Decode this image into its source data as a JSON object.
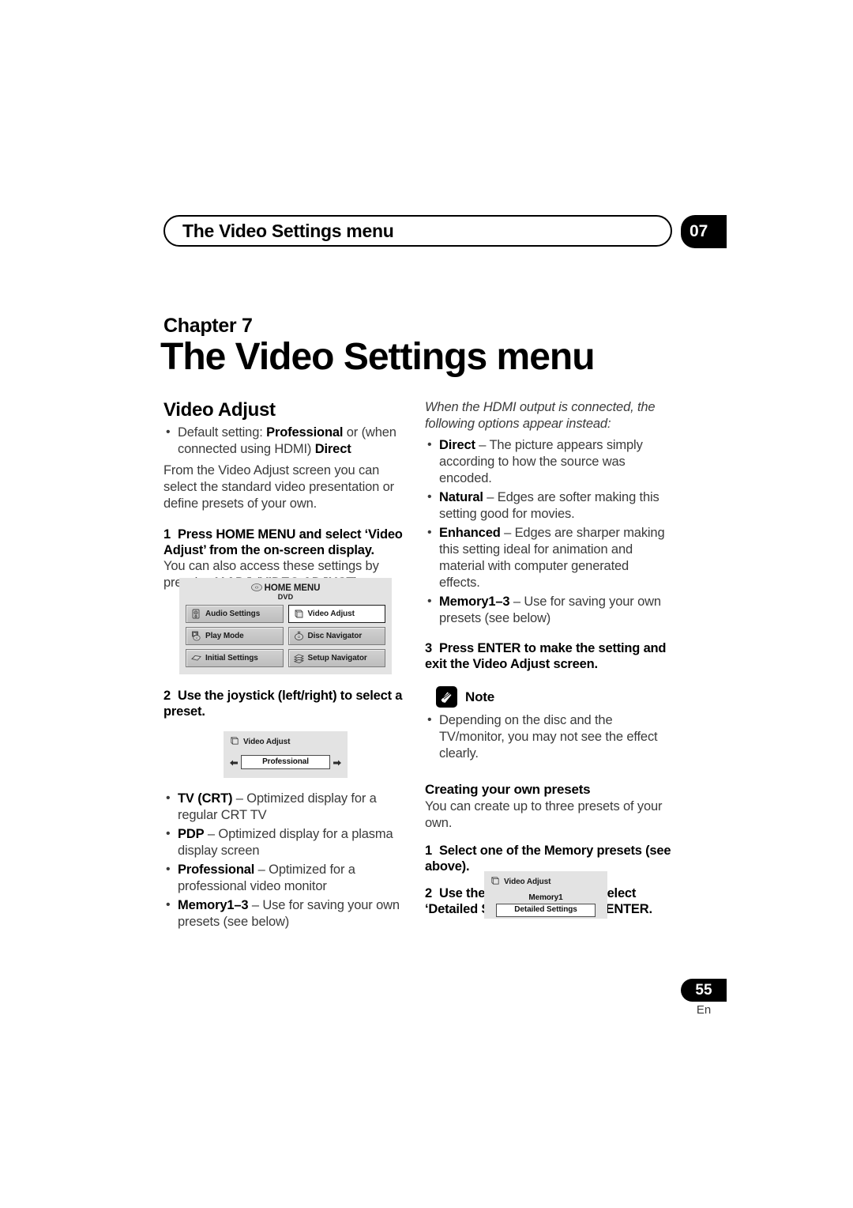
{
  "header": {
    "running_title": "The Video Settings menu",
    "chapter_number": "07"
  },
  "chapter": {
    "label": "Chapter 7",
    "title": "The Video Settings menu"
  },
  "left_column": {
    "section_title": "Video Adjust",
    "default_setting_bullet": {
      "lead": "Default setting: ",
      "bold1": "Professional",
      "mid": " or (when connected using HDMI) ",
      "bold2": "Direct"
    },
    "intro": "From the Video Adjust screen you can select the standard video presentation or define presets of your own.",
    "step1": {
      "num": "1",
      "text": "Press HOME MENU and select ‘Video Adjust’ from the on-screen display."
    },
    "step1_body": {
      "part1": "You can also access these settings by pressing ",
      "bold1": "V.ADJ",
      "part2": " (",
      "bold2": "VIDEO ADJUST",
      "part3": ")."
    },
    "home_menu_osd": {
      "title": "HOME MENU",
      "subtitle": "DVD",
      "buttons": [
        {
          "label": "Audio Settings",
          "icon": "speaker-icon",
          "selected": false
        },
        {
          "label": "Video Adjust",
          "icon": "monitor-icon",
          "selected": true
        },
        {
          "label": "Play Mode",
          "icon": "play-disc-icon",
          "selected": false
        },
        {
          "label": "Disc Navigator",
          "icon": "disc-navigator-icon",
          "selected": false
        },
        {
          "label": "Initial Settings",
          "icon": "sliders-icon",
          "selected": false
        },
        {
          "label": "Setup Navigator",
          "icon": "setup-navigator-icon",
          "selected": false
        }
      ]
    },
    "step2": {
      "num": "2",
      "text": "Use the joystick (left/right) to select a preset."
    },
    "video_adjust_osd": {
      "title": "Video Adjust",
      "value": "Professional",
      "left_arrow": "left-arrow-icon",
      "right_arrow": "right-arrow-icon"
    },
    "preset_bullets": [
      {
        "term": "TV (CRT)",
        "dash": " – ",
        "desc": "Optimized display for a regular CRT TV"
      },
      {
        "term": "PDP",
        "dash": " – ",
        "desc": "Optimized display for a plasma display screen"
      },
      {
        "term": "Professional",
        "dash": " – ",
        "desc": "Optimized for a professional video monitor"
      },
      {
        "term": "Memory1–3",
        "dash": " – ",
        "desc": "Use for saving your own presets (see below)"
      }
    ]
  },
  "right_column": {
    "hdmi_intro": "When the HDMI output is connected, the following options appear instead:",
    "hdmi_bullets": [
      {
        "term": "Direct",
        "dash": " – ",
        "desc": "The picture appears simply according to how the source was encoded."
      },
      {
        "term": "Natural",
        "dash": " – ",
        "desc": "Edges are softer making this setting good for movies."
      },
      {
        "term": "Enhanced",
        "dash": " – ",
        "desc": "Edges are sharper making this setting ideal for animation and material with computer generated effects."
      },
      {
        "term": "Memory1–3",
        "dash": " – ",
        "desc": "Use for saving your own presets (see below)"
      }
    ],
    "step3": {
      "num": "3",
      "text": "Press ENTER to make the setting and exit the Video Adjust screen."
    },
    "note": {
      "label": "Note",
      "icon": "pencil-note-icon",
      "items": [
        "Depending on the disc and the TV/monitor, you may not see the effect clearly."
      ]
    },
    "presets_section": {
      "title": "Creating your own presets",
      "intro": "You can create up to three presets of your own.",
      "step1": {
        "num": "1",
        "text": "Select one of the Memory presets (see above)."
      },
      "step2": {
        "num": "2",
        "text": "Use the joystick (down) to select ‘Detailed Settings’ then press ENTER."
      },
      "memory_osd": {
        "title": "Video Adjust",
        "memory_label": "Memory1",
        "value": "Detailed Settings"
      }
    }
  },
  "footer": {
    "page_number": "55",
    "language": "En"
  }
}
